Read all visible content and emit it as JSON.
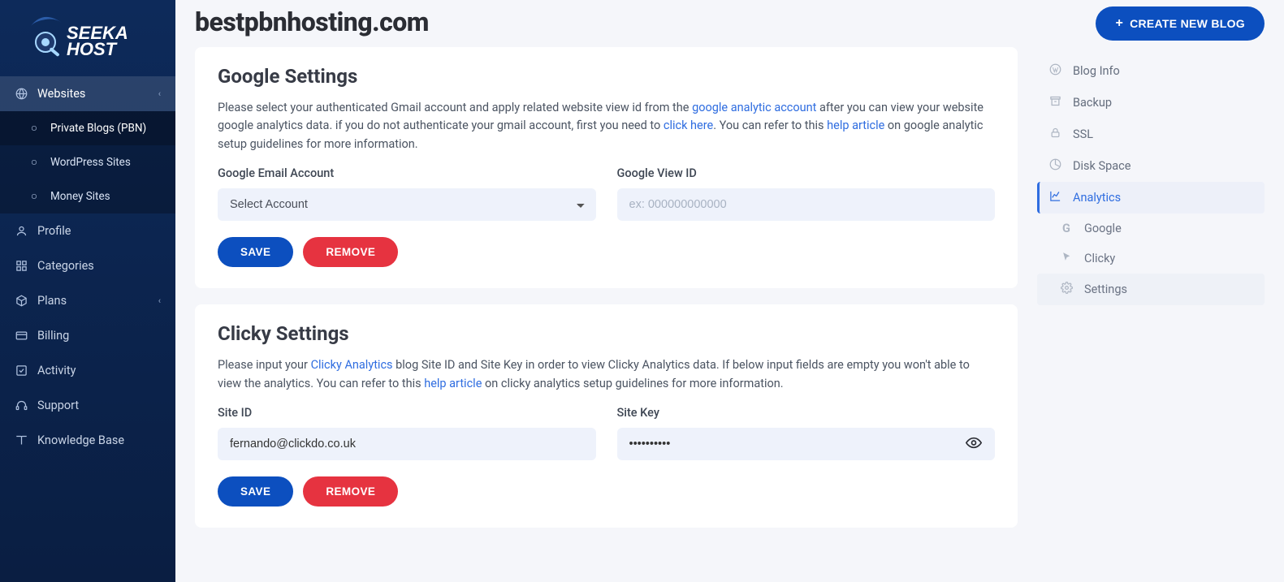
{
  "brand": "SeekaHost",
  "sidebar": {
    "parent_label": "Websites",
    "items": [
      {
        "label": "Private Blogs (PBN)"
      },
      {
        "label": "WordPress Sites"
      },
      {
        "label": "Money Sites"
      }
    ],
    "links": [
      {
        "label": "Profile"
      },
      {
        "label": "Categories"
      },
      {
        "label": "Plans"
      },
      {
        "label": "Billing"
      },
      {
        "label": "Activity"
      },
      {
        "label": "Support"
      },
      {
        "label": "Knowledge Base"
      }
    ]
  },
  "header": {
    "title": "bestpbnhosting.com",
    "create_label": "CREATE NEW BLOG"
  },
  "google": {
    "title": "Google Settings",
    "desc_1": "Please select your authenticated Gmail account and apply related website view id from the ",
    "link_1": "google analytic account",
    "desc_2": " after you can view your website google analytics data. if you do not authenticate your gmail account, first you need to ",
    "link_2": "click here",
    "desc_3": ". You can refer to this ",
    "link_3": "help article",
    "desc_4": " on google analytic setup guidelines for more information.",
    "email_label": "Google Email Account",
    "email_select_value": "Select Account",
    "view_label": "Google View ID",
    "view_placeholder": "ex: 000000000000",
    "save": "SAVE",
    "remove": "REMOVE"
  },
  "clicky": {
    "title": "Clicky Settings",
    "desc_1": "Please input your ",
    "link_1": "Clicky Analytics",
    "desc_2": " blog Site ID and Site Key in order to view Clicky Analytics data. If below input fields are empty you won't able to view the analytics. You can refer to this ",
    "link_2": "help article",
    "desc_3": " on clicky analytics setup guidelines for more information.",
    "siteid_label": "Site ID",
    "siteid_value": "fernando@clickdo.co.uk",
    "sitekey_label": "Site Key",
    "sitekey_value": "••••••••••",
    "save": "SAVE",
    "remove": "REMOVE"
  },
  "rightnav": {
    "items": [
      {
        "label": "Blog Info"
      },
      {
        "label": "Backup"
      },
      {
        "label": "SSL"
      },
      {
        "label": "Disk Space"
      },
      {
        "label": "Analytics"
      },
      {
        "label": "Google"
      },
      {
        "label": "Clicky"
      },
      {
        "label": "Settings"
      }
    ]
  }
}
